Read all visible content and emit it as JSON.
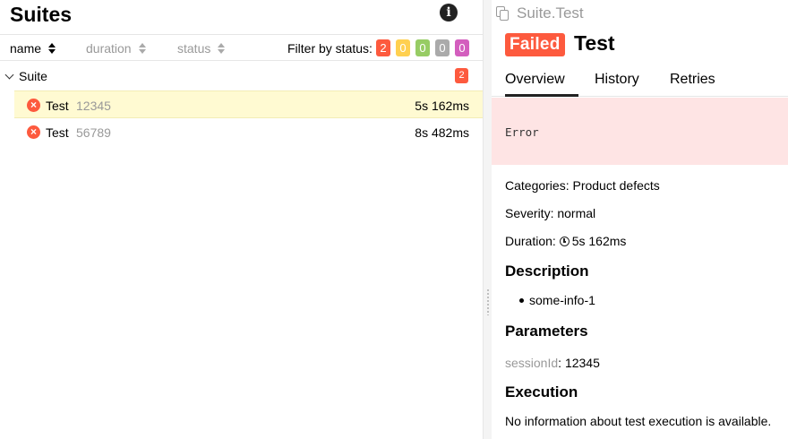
{
  "left_pane": {
    "title": "Suites",
    "sort": {
      "name": "name",
      "duration": "duration",
      "status": "status"
    },
    "filter": {
      "label": "Filter by status:",
      "badges": [
        {
          "value": "2",
          "color": "#fd5a3e"
        },
        {
          "value": "0",
          "color": "#ffd050"
        },
        {
          "value": "0",
          "color": "#97cc64"
        },
        {
          "value": "0",
          "color": "#aaaaaa"
        },
        {
          "value": "0",
          "color": "#d35ebe"
        }
      ]
    },
    "suite": {
      "name": "Suite",
      "count": "2"
    },
    "tests": [
      {
        "name": "Test",
        "uid": "12345",
        "duration": "5s 162ms"
      },
      {
        "name": "Test",
        "uid": "56789",
        "duration": "8s 482ms"
      }
    ]
  },
  "right_pane": {
    "breadcrumb": "Suite.Test",
    "status": "Failed",
    "title": "Test",
    "tabs": [
      "Overview",
      "History",
      "Retries"
    ],
    "error": "Error",
    "categories": "Categories: Product defects",
    "severity": "Severity: normal",
    "duration_label": "Duration:",
    "duration_value": "5s 162ms",
    "description_heading": "Description",
    "description_items": [
      "some-info-1"
    ],
    "parameters_heading": "Parameters",
    "parameter": {
      "key": "sessionId",
      "value": "12345"
    },
    "execution_heading": "Execution",
    "execution_text": "No information about test execution is available."
  },
  "colors": {
    "failed": "#fd5a3e",
    "selected_row": "#fffad2",
    "error_bg": "#fee4e4"
  }
}
